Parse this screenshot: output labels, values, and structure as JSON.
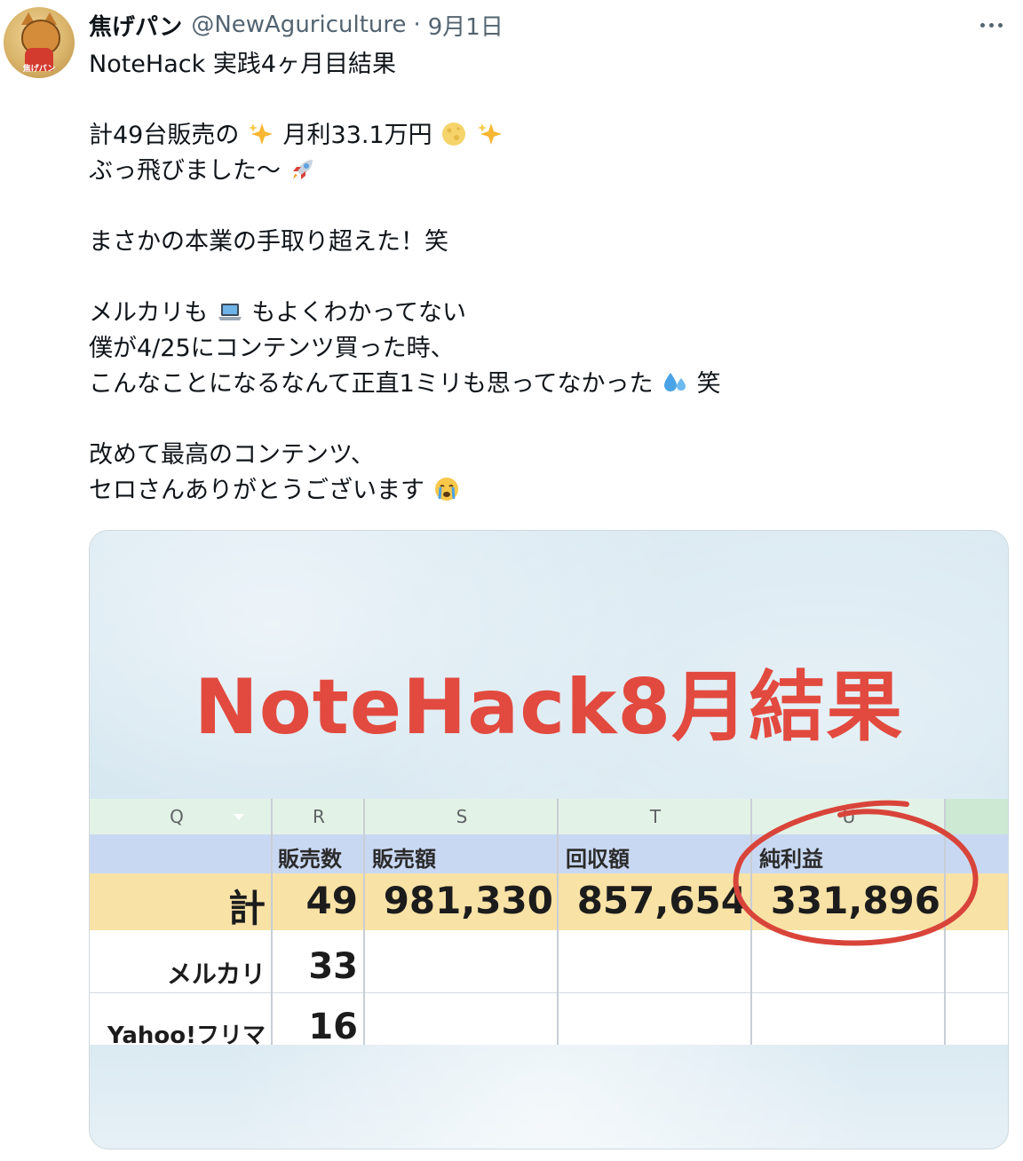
{
  "tweet": {
    "display_name": "焦げパン",
    "handle": "@NewAguriculture",
    "separator": "·",
    "date": "9月1日",
    "avatar_text": "焦げパン",
    "lines": {
      "l1": "NoteHack 実践4ヶ月目結果",
      "l2a": "計49台販売の",
      "l2b": "月利33.1万円",
      "l3": "ぶっ飛びました〜",
      "l4": "まさかの本業の手取り超えた！笑",
      "l5a": "メルカリも",
      "l5b": "もよくわかってない",
      "l6": "僕が4/25にコンテンツ買った時、",
      "l7a": "こんなことになるなんて正直1ミリも思ってなかった",
      "l7b": "笑",
      "l8": "改めて最高のコンテンツ、",
      "l9": "セロさんありがとうございます"
    },
    "emojis": [
      "sparkles-icon",
      "moon-icon",
      "rocket-icon",
      "laptop-icon",
      "sweat-droplets-icon",
      "crying-face-icon"
    ]
  },
  "media": {
    "title": "NoteHack8月結果",
    "accent_color": "#e24a3f",
    "columns": [
      "Q",
      "R",
      "S",
      "T",
      "U"
    ],
    "labels": {
      "r": "販売数",
      "s": "販売額",
      "t": "回収額",
      "u": "純利益"
    },
    "total": {
      "label": "計",
      "count": "49",
      "sales": "981,330",
      "recovered": "857,654",
      "profit": "331,896"
    },
    "rows": [
      {
        "label": "メルカリ",
        "count": "33"
      },
      {
        "label": "Yahoo!フリマ",
        "count": "16"
      }
    ]
  }
}
